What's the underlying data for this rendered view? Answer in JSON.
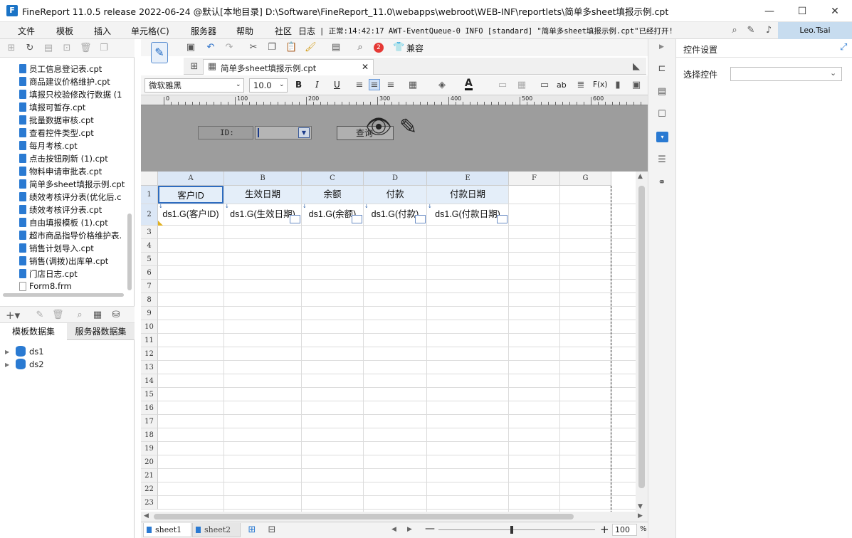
{
  "window": {
    "title": "FineReport 11.0.5 release 2022-06-24 @默认[本地目录]     D:\\Software\\FineReport_11.0\\webapps\\webroot\\WEB-INF\\reportlets\\简单多sheet填报示例.cpt",
    "minimize": "—",
    "maximize": "☐",
    "close": "✕",
    "logo": "F"
  },
  "menu": {
    "items": [
      "文件",
      "模板",
      "插入",
      "单元格(C)",
      "服务器",
      "帮助",
      "社区"
    ],
    "log_label": "日志",
    "log_text": "| 正常:14:42:17 AWT-EventQueue-0 INFO [standard] \"简单多sheet填报示例.cpt\"已经打开!",
    "user": "Leo.Tsai"
  },
  "files": [
    "员工信息登记表.cpt",
    "商品建议价格维护.cpt",
    "填报只校验修改行数据 (1",
    "填报可暂存.cpt",
    "批量数据审核.cpt",
    "查看控件类型.cpt",
    "每月考核.cpt",
    "点击按钮刷新 (1).cpt",
    "物料申请审批表.cpt",
    "简单多sheet填报示例.cpt",
    "绩效考核评分表(优化后.c",
    "绩效考核评分表.cpt",
    "自由填报模板 (1).cpt",
    "超市商品指导价格维护表.",
    "销售计划导入.cpt",
    "销售(调拨)出库单.cpt",
    "门店日志.cpt",
    "Form8.frm"
  ],
  "dataset_tabs": [
    "模板数据集",
    "服务器数据集"
  ],
  "datasets": [
    "ds1",
    "ds2"
  ],
  "toolbar": {
    "badge": "2",
    "compat": "兼容"
  },
  "doc_tab": "简单多sheet填报示例.cpt",
  "format": {
    "font": "微软雅黑",
    "size": "10.0",
    "bold": "B",
    "italic": "I",
    "underline": "U",
    "func": "F(x)",
    "ab": "ab"
  },
  "ruler": [
    "0",
    "100",
    "200",
    "300",
    "400",
    "500",
    "600"
  ],
  "param": {
    "id_label": "ID:",
    "query_button": "查询"
  },
  "columns": [
    "A",
    "B",
    "C",
    "D",
    "E",
    "F",
    "G"
  ],
  "rows": [
    "1",
    "2",
    "3",
    "4",
    "5",
    "6",
    "7",
    "8",
    "9",
    "10",
    "11",
    "12",
    "13",
    "14",
    "15",
    "16",
    "17",
    "18",
    "19",
    "20",
    "21",
    "22",
    "23"
  ],
  "headers": [
    "客户ID",
    "生效日期",
    "余额",
    "付款",
    "付款日期"
  ],
  "cells": [
    "ds1.G(客户ID)",
    "ds1.G(生效日期)",
    "ds1.G(余额)",
    "ds1.G(付款)",
    "ds1.G(付款日期)"
  ],
  "sheets": [
    "sheet1",
    "sheet2"
  ],
  "zoom": "100",
  "zoom_unit": "%",
  "right_panel": {
    "title": "控件设置",
    "select_label": "选择控件",
    "select_value": ""
  }
}
